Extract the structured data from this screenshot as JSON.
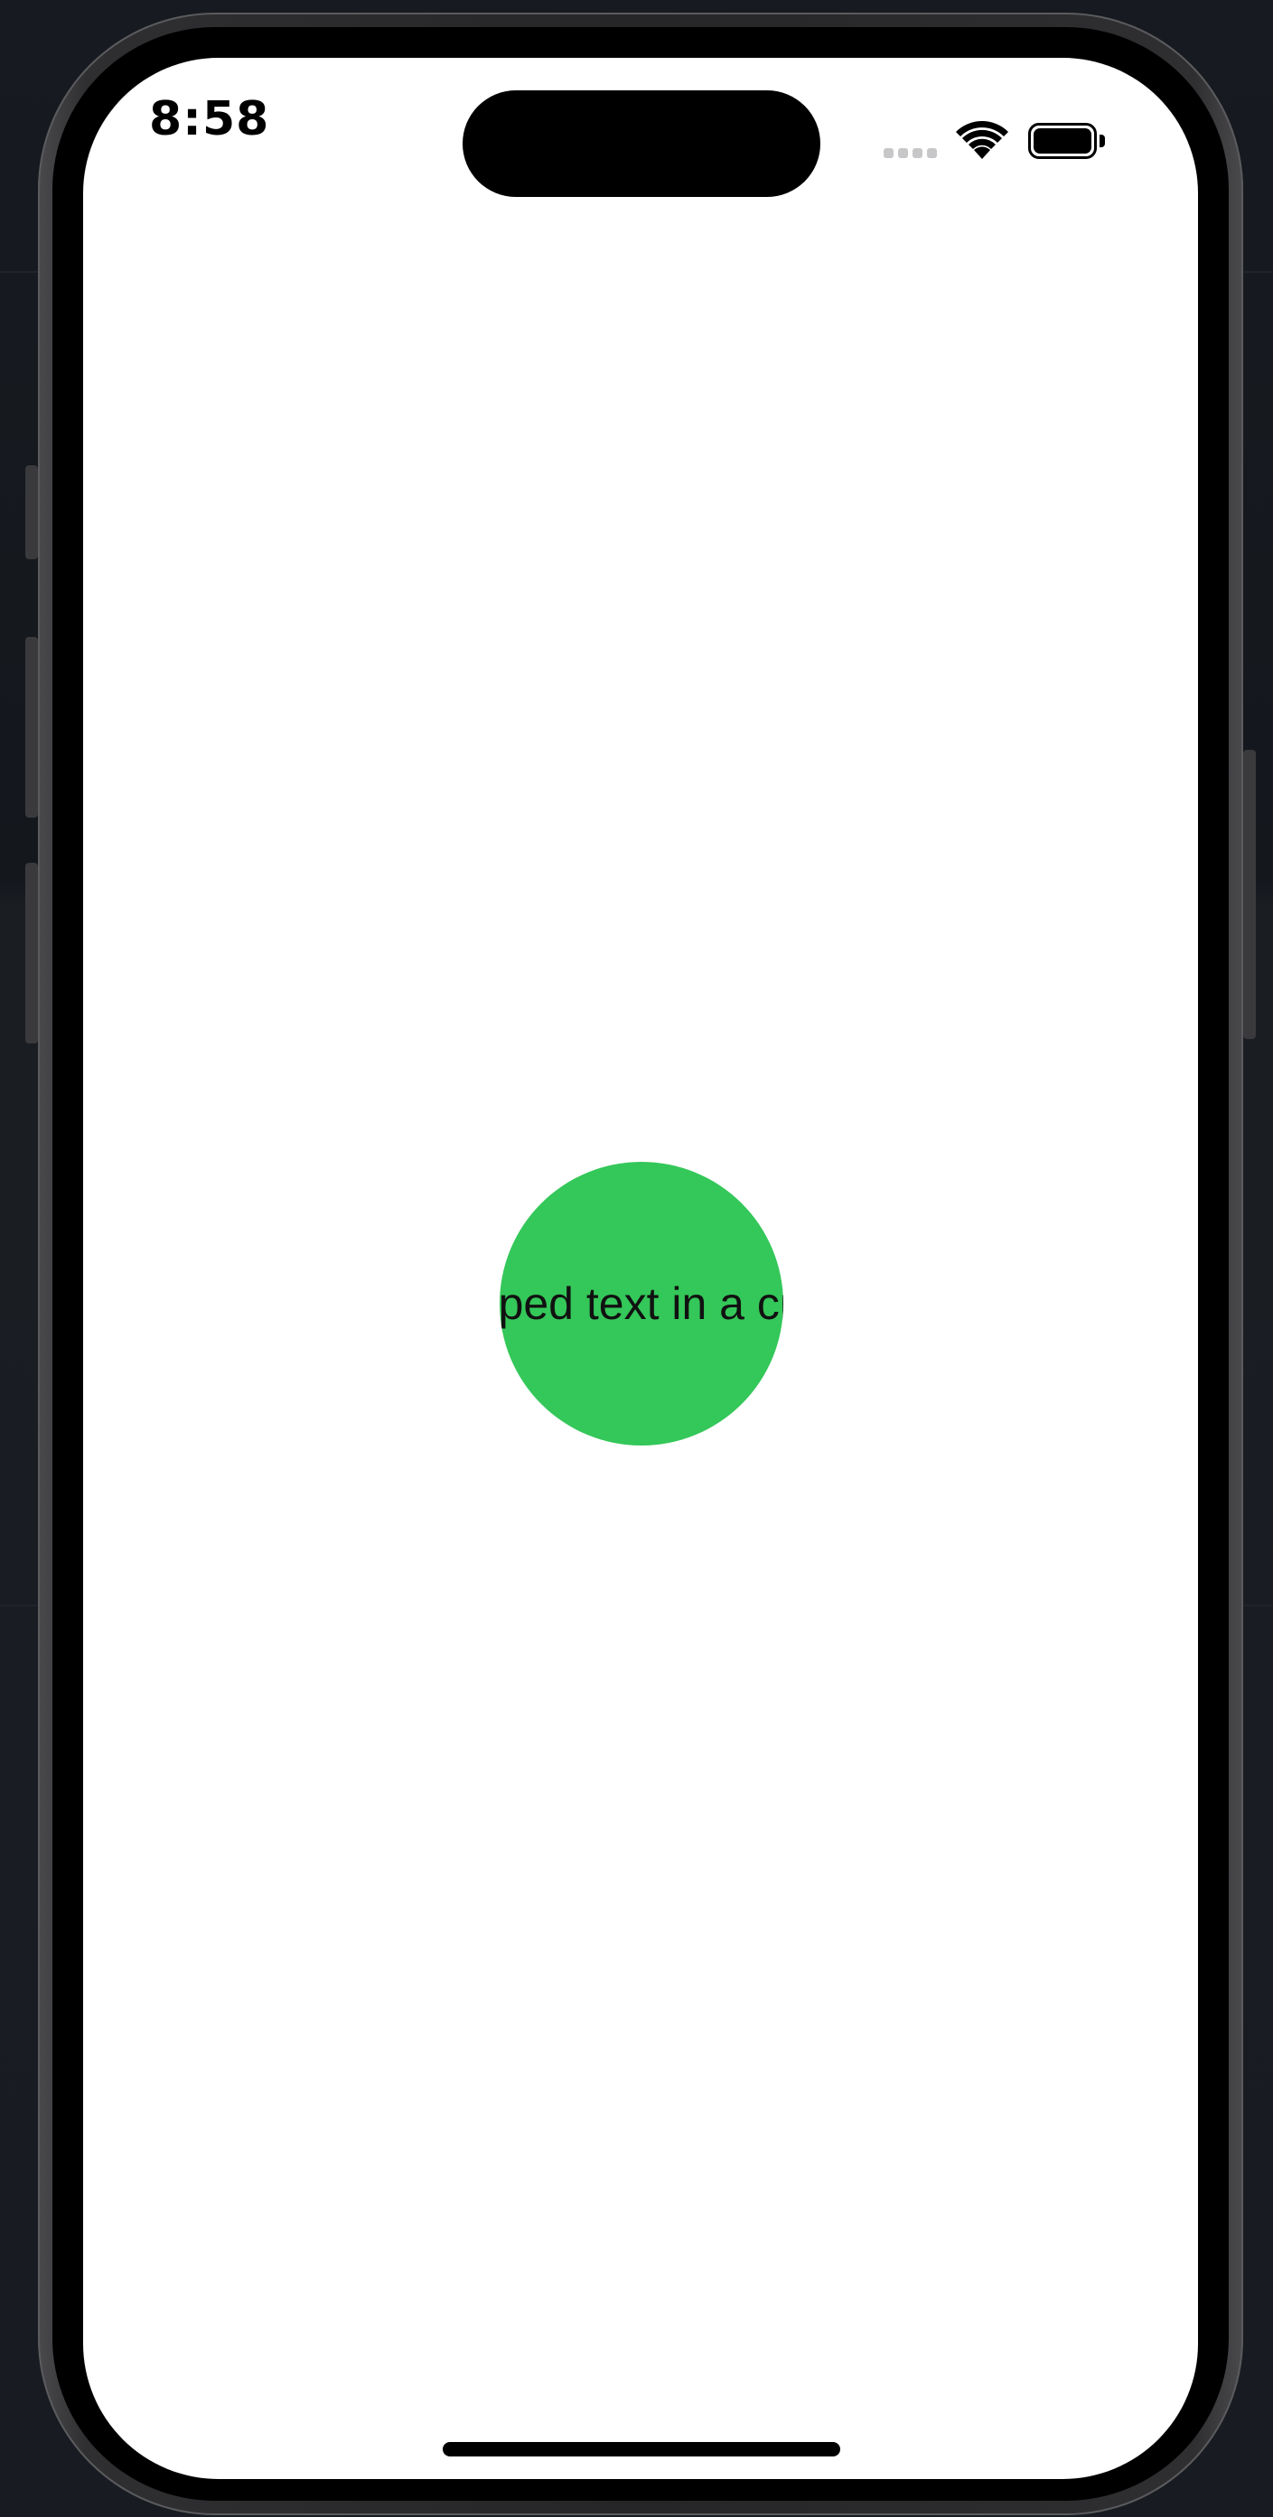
{
  "status_bar": {
    "time": "8:58",
    "signal_icon": "cellular-signal-icon",
    "wifi_icon": "wifi-icon",
    "battery_icon": "battery-icon"
  },
  "content": {
    "circle_text": "Clipped text in a circle",
    "circle_color": "#34c759",
    "background_color": "#ffffff"
  },
  "device": {
    "frame_color": "#2c2c2e",
    "home_indicator": "home-indicator"
  }
}
